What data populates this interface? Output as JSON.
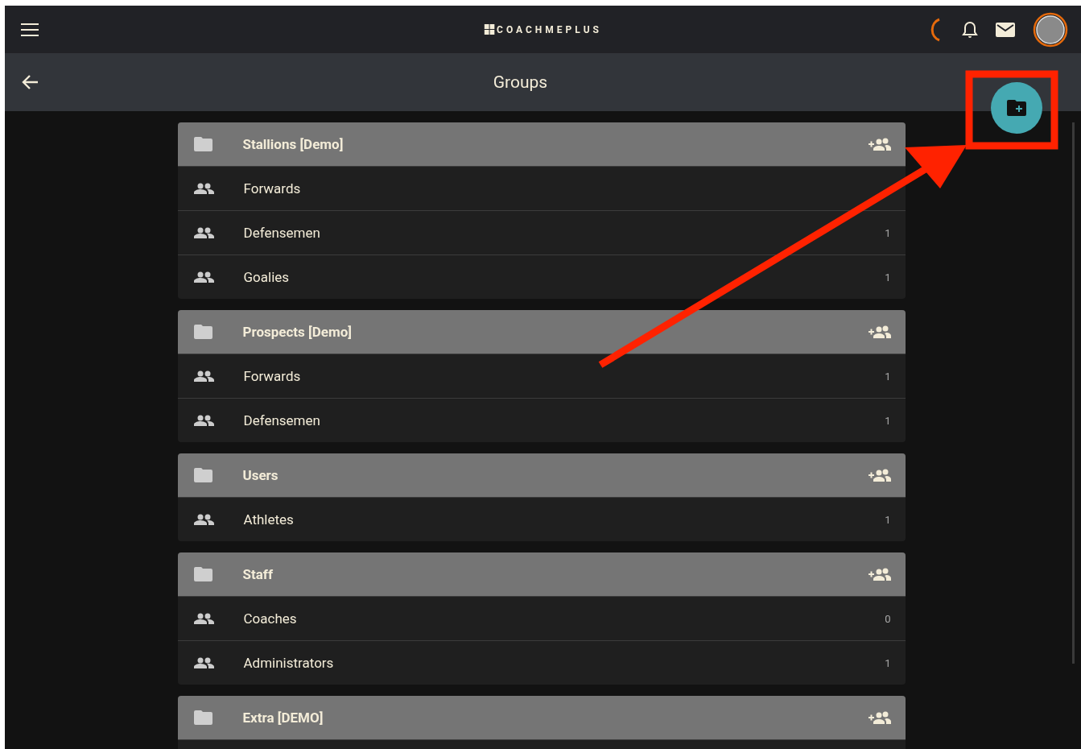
{
  "app_bar": {
    "logo": "COACHMEPLUS"
  },
  "title_bar": {
    "title": "Groups"
  },
  "groups": [
    {
      "name": "Stallions [Demo]",
      "subgroups": [
        {
          "name": "Forwards"
        },
        {
          "name": "Defensemen",
          "count": "1"
        },
        {
          "name": "Goalies",
          "count": "1"
        }
      ]
    },
    {
      "name": "Prospects [Demo]",
      "subgroups": [
        {
          "name": "Forwards",
          "count": "1"
        },
        {
          "name": "Defensemen",
          "count": "1"
        }
      ]
    },
    {
      "name": "Users",
      "subgroups": [
        {
          "name": "Athletes",
          "count": "1"
        }
      ]
    },
    {
      "name": "Staff",
      "subgroups": [
        {
          "name": "Coaches",
          "count": "0"
        },
        {
          "name": "Administrators",
          "count": "1"
        }
      ]
    },
    {
      "name": "Extra [DEMO]"
    }
  ]
}
